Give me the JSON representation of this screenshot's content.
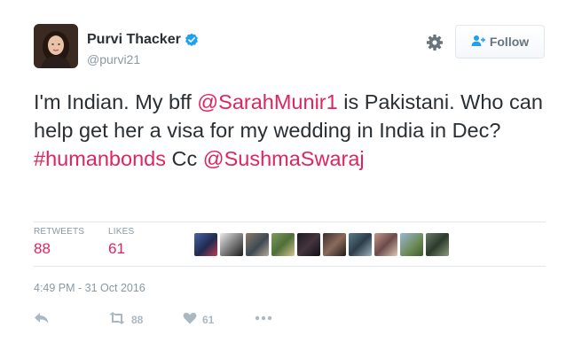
{
  "user": {
    "name": "Purvi Thacker",
    "handle": "@purvi21",
    "verified": true
  },
  "header": {
    "gear_icon": "gear-icon",
    "follow_label": "Follow",
    "follow_icon": "add-user-icon"
  },
  "tweet": {
    "text_1": "I'm Indian. My bff ",
    "mention_1": "@SarahMunir1",
    "text_2": " is Pakistani. Who can help get her a visa for my wedding in India in Dec? ",
    "hashtag": "#humanbonds",
    "text_3": " Cc ",
    "mention_2": "@SushmaSwaraj"
  },
  "stats": {
    "retweets_label": "RETWEETS",
    "retweets_value": "88",
    "likes_label": "LIKES",
    "likes_value": "61"
  },
  "timestamp": "4:49 PM - 31 Oct 2016",
  "actions": {
    "reply_icon": "reply-icon",
    "retweet_icon": "retweet-icon",
    "retweet_count": "88",
    "like_icon": "heart-icon",
    "like_count": "61",
    "more_icon": "more-icon"
  },
  "colors": {
    "accent": "#e0245e",
    "text": "#292f33",
    "muted": "#8899a6",
    "divider": "#e1e8ed",
    "verified": "#1da1f2",
    "action_icons": "#aab8c2"
  }
}
